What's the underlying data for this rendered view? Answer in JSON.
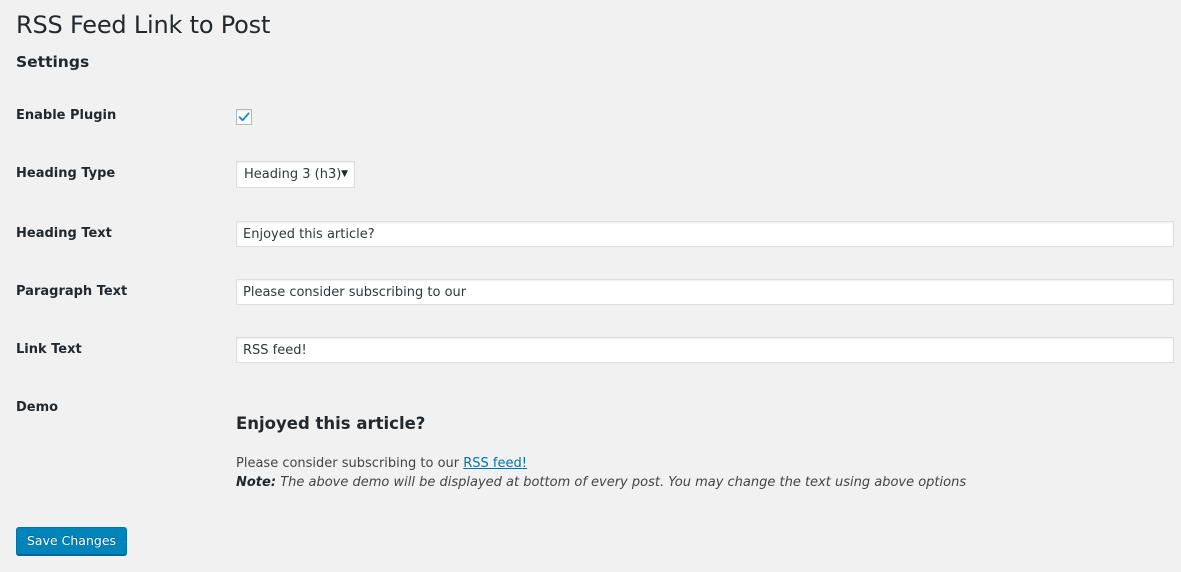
{
  "page": {
    "title": "RSS Feed Link to Post",
    "section_title": "Settings"
  },
  "fields": {
    "enable_plugin": {
      "label": "Enable Plugin",
      "checked": true
    },
    "heading_type": {
      "label": "Heading Type",
      "selected": "Heading 3 (h3)"
    },
    "heading_text": {
      "label": "Heading Text",
      "value": "Enjoyed this article?"
    },
    "paragraph_text": {
      "label": "Paragraph Text",
      "value": "Please consider subscribing to our"
    },
    "link_text": {
      "label": "Link Text",
      "value": "RSS feed!"
    }
  },
  "demo": {
    "label": "Demo",
    "heading": "Enjoyed this article?",
    "paragraph": "Please consider subscribing to our",
    "link": "RSS feed!",
    "note_label": "Note:",
    "note_text": "The above demo will be displayed at bottom of every post. You may change the text using above options"
  },
  "actions": {
    "save_label": "Save Changes"
  },
  "colors": {
    "background": "#f1f1f1",
    "primary_button": "#0085ba",
    "link": "#0073aa",
    "checkmark": "#1e8cbe"
  }
}
